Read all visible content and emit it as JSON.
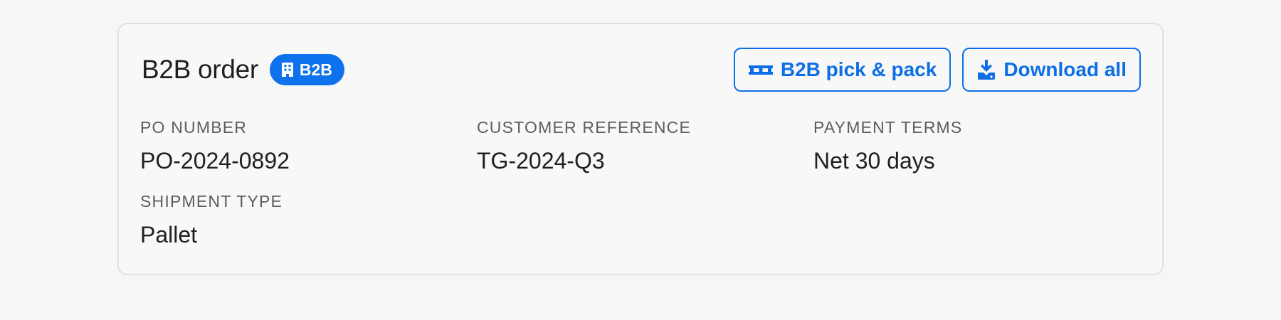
{
  "header": {
    "title": "B2B order",
    "badge": {
      "label": "B2B",
      "icon": "building-icon",
      "color": "#0d72ec"
    }
  },
  "actions": {
    "pick_pack": {
      "label": "B2B pick & pack",
      "icon": "pallet-icon"
    },
    "download_all": {
      "label": "Download all",
      "icon": "download-icon"
    }
  },
  "fields": {
    "po_number": {
      "label": "PO NUMBER",
      "value": "PO-2024-0892"
    },
    "customer_reference": {
      "label": "CUSTOMER REFERENCE",
      "value": "TG-2024-Q3"
    },
    "payment_terms": {
      "label": "PAYMENT TERMS",
      "value": "Net 30 days"
    },
    "shipment_type": {
      "label": "SHIPMENT TYPE",
      "value": "Pallet"
    }
  },
  "colors": {
    "accent": "#0d6fe6",
    "label_text": "#5d5d5d",
    "value_text": "#1f1f1f"
  }
}
